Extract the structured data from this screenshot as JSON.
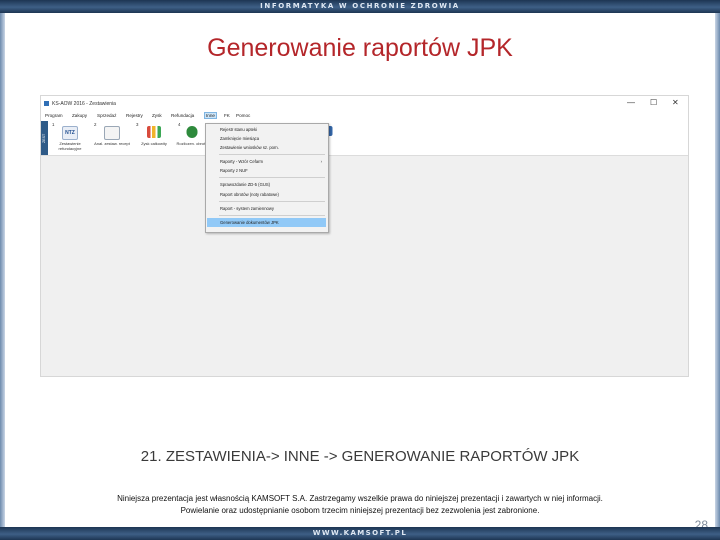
{
  "banner_top": "INFORMATYKA W OCHRONIE ZDROWIA",
  "banner_bottom": "WWW.KAMSOFT.PL",
  "slide_title": "Generowanie raportów JPK",
  "app": {
    "window_title": "KS-AOW 2016 - Zestawienia",
    "window_controls": [
      "—",
      "☐",
      "✕"
    ],
    "menu": [
      "Program",
      "Zakupy",
      "Sprzedaż",
      "Rejestry",
      "Zysk",
      "Refundacja",
      "Inne",
      "FK",
      "Pomoc"
    ],
    "active_menu": "Inne",
    "ribbon_side_label": "ZEST",
    "ribbon": [
      {
        "num": "1",
        "label": "Zestawienie refundacyjne",
        "icon": "ntz-document-icon"
      },
      {
        "num": "2",
        "label": "Anal. zestaw. recept",
        "icon": "prescription-icon"
      },
      {
        "num": "3",
        "label": "Zysk całkowity",
        "icon": "bar-chart-icon"
      },
      {
        "num": "4",
        "label": "Rozliczen. obrotu",
        "icon": "money-bag-icon"
      }
    ],
    "dropdown": [
      {
        "label": "Rejestr stanu apteki"
      },
      {
        "label": "Zamknięcie miesiąca"
      },
      {
        "label": "Zestawienie wniosków sz. porn."
      },
      {
        "label": "Raporty - Wzór Cefarm",
        "submenu": true
      },
      {
        "label": "Raporty z NUF"
      },
      {
        "label": "Sprawozdanie ZD-5 (GUS)"
      },
      {
        "label": "Raport obrotów (noty rabatowe)"
      },
      {
        "label": "Raport - system zamiennowy"
      },
      {
        "label": "Generowanie dokumentów JPK",
        "highlighted": true
      }
    ],
    "colors": {
      "highlight": "#91c9f7",
      "ribbon_side": "#2f5b88"
    }
  },
  "caption": "21. ZESTAWIENIA-> INNE -> GENEROWANIE RAPORTÓW JPK",
  "footnote_line1": "Niniejsza prezentacja jest własnością KAMSOFT S.A. Zastrzegamy wszelkie prawa do niniejszej prezentacji i zawartych w niej informacji.",
  "footnote_line2": "Powielanie oraz udostępnianie osobom trzecim niniejszej prezentacji bez zezwolenia jest zabronione.",
  "page_number": "28",
  "colors": {
    "title": "#b4262a",
    "banner": "#1d3553"
  }
}
